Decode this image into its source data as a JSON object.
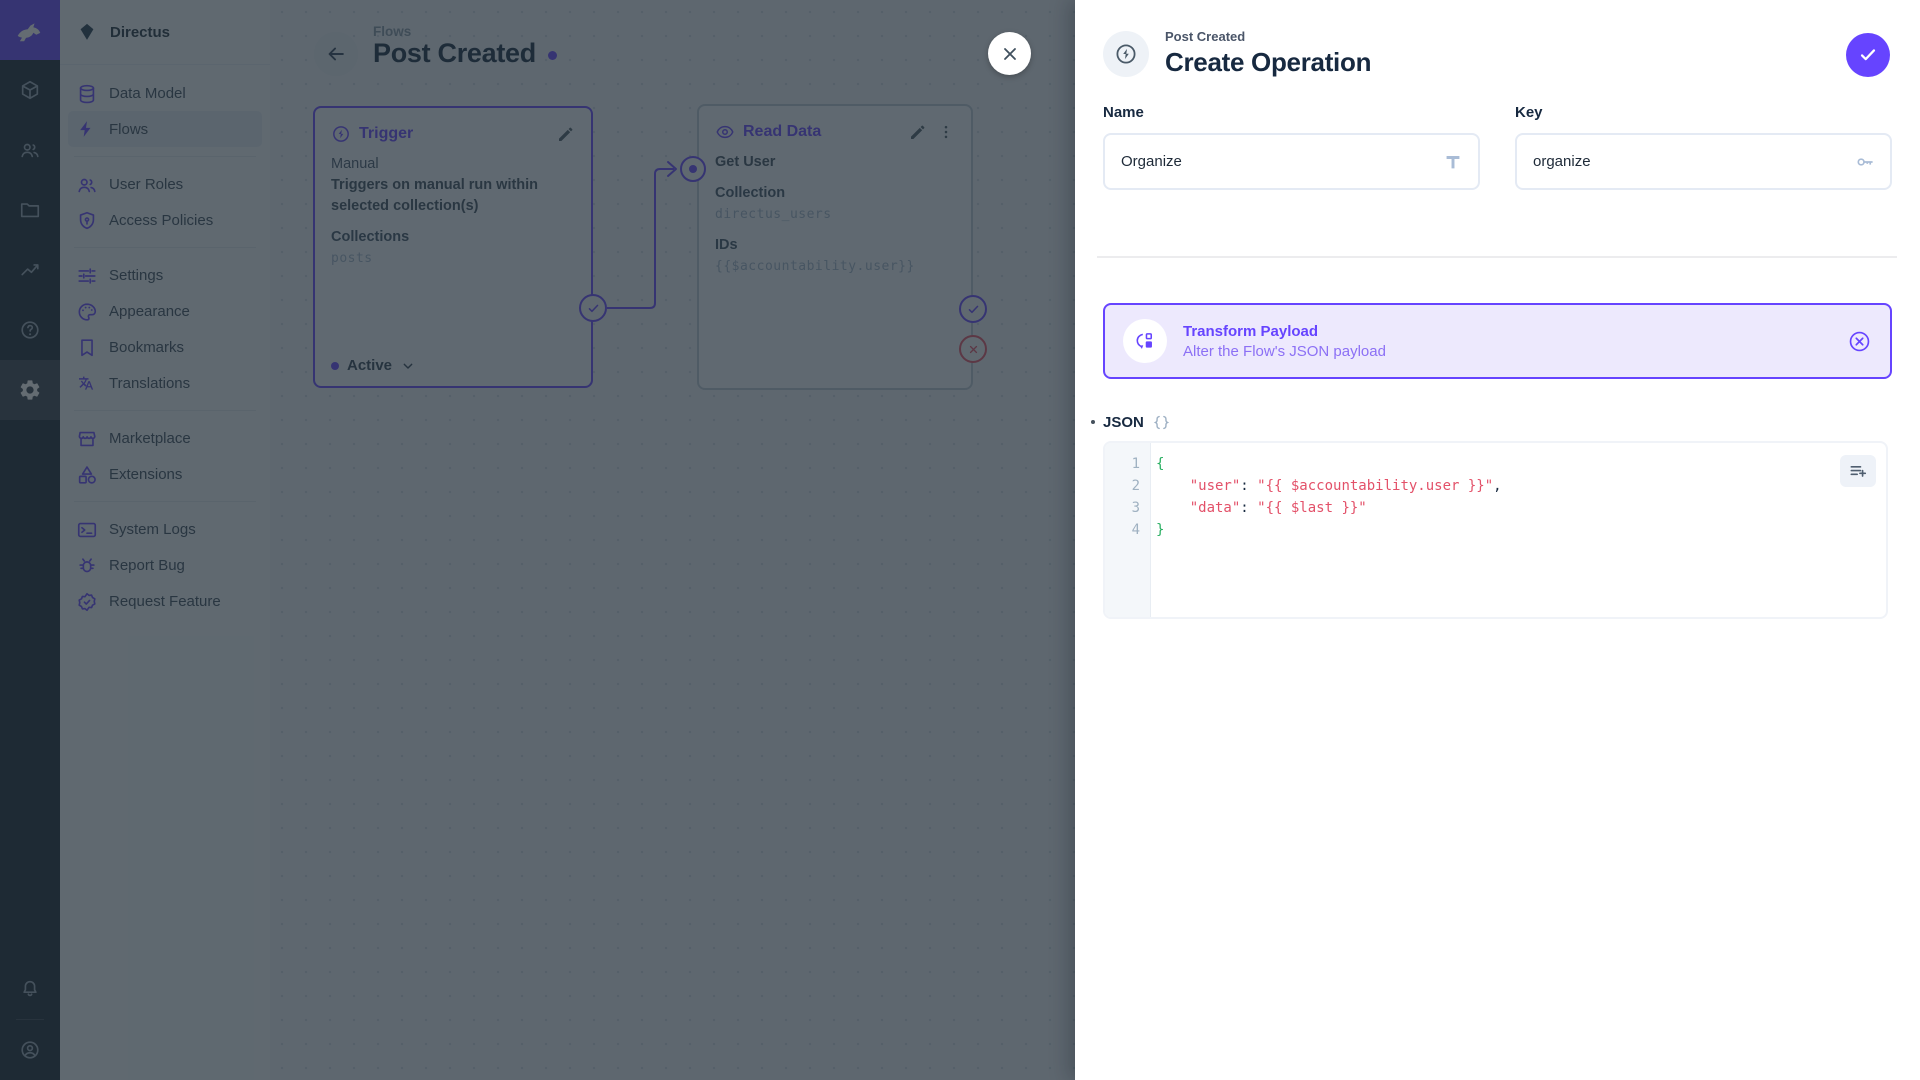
{
  "colors": {
    "accent": "#6644ff",
    "reject": "#e35169",
    "code_string": "#e35169",
    "code_brace": "#27ae60"
  },
  "module_bar": {
    "logo_icon": "directus-rabbit-logo",
    "modules": [
      {
        "icon": "box-icon",
        "active": false
      },
      {
        "icon": "users-icon",
        "active": false
      },
      {
        "icon": "folder-icon",
        "active": false
      },
      {
        "icon": "insights-icon",
        "active": false
      },
      {
        "icon": "help-icon",
        "active": false
      },
      {
        "icon": "gear-icon",
        "active": true
      }
    ],
    "bottom": [
      {
        "icon": "bell-icon"
      },
      {
        "icon": "avatar-icon"
      }
    ]
  },
  "sidebar": {
    "project_name": "Directus",
    "project_icon": "gem-icon",
    "groups": [
      {
        "items": [
          {
            "label": "Data Model",
            "icon": "database-icon",
            "active": false
          },
          {
            "label": "Flows",
            "icon": "bolt-icon",
            "active": true
          }
        ]
      },
      {
        "items": [
          {
            "label": "User Roles",
            "icon": "users-icon",
            "active": false
          },
          {
            "label": "Access Policies",
            "icon": "shield-lock-icon",
            "active": false
          }
        ]
      },
      {
        "items": [
          {
            "label": "Settings",
            "icon": "tune-icon",
            "active": false
          },
          {
            "label": "Appearance",
            "icon": "palette-icon",
            "active": false
          },
          {
            "label": "Bookmarks",
            "icon": "bookmark-icon",
            "active": false
          },
          {
            "label": "Translations",
            "icon": "translate-icon",
            "active": false
          }
        ]
      },
      {
        "items": [
          {
            "label": "Marketplace",
            "icon": "storefront-icon",
            "active": false
          },
          {
            "label": "Extensions",
            "icon": "category-icon",
            "active": false
          }
        ]
      },
      {
        "items": [
          {
            "label": "System Logs",
            "icon": "terminal-icon",
            "active": false
          },
          {
            "label": "Report Bug",
            "icon": "bug-icon",
            "active": false
          },
          {
            "label": "Request Feature",
            "icon": "verified-icon",
            "active": false
          }
        ]
      }
    ]
  },
  "canvas": {
    "breadcrumb": "Flows",
    "title": "Post Created",
    "trigger_card": {
      "title": "Trigger",
      "icon": "bolt-circle-icon",
      "name": "Manual",
      "description": "Triggers on manual run within selected collection(s)",
      "field_label": "Collections",
      "field_value": "posts",
      "status": "Active"
    },
    "operation_card": {
      "title": "Read Data",
      "icon": "eye-icon",
      "name": "Get User",
      "fields": [
        {
          "label": "Collection",
          "value": "directus_users"
        },
        {
          "label": "IDs",
          "value": "{{$accountability.user}}"
        }
      ]
    }
  },
  "drawer": {
    "breadcrumb": "Post Created",
    "title": "Create Operation",
    "header_icon": "bolt-circle-icon",
    "fields": {
      "name_label": "Name",
      "name_value": "Organize",
      "key_label": "Key",
      "key_value": "organize"
    },
    "transform": {
      "title": "Transform Payload",
      "subtitle": "Alter the Flow's JSON payload",
      "icon": "transform-icon"
    },
    "json": {
      "label": "JSON",
      "lines": [
        {
          "segments": [
            {
              "text": "{",
              "style": "brace"
            }
          ]
        },
        {
          "segments": [
            {
              "text": "    ",
              "style": "plain"
            },
            {
              "text": "\"user\"",
              "style": "string"
            },
            {
              "text": ": ",
              "style": "plain"
            },
            {
              "text": "\"{{ $accountability.user }}\"",
              "style": "string"
            },
            {
              "text": ",",
              "style": "plain"
            }
          ]
        },
        {
          "segments": [
            {
              "text": "    ",
              "style": "plain"
            },
            {
              "text": "\"data\"",
              "style": "string"
            },
            {
              "text": ": ",
              "style": "plain"
            },
            {
              "text": "\"{{ $last }}\"",
              "style": "string"
            }
          ]
        },
        {
          "segments": [
            {
              "text": "}",
              "style": "brace"
            }
          ]
        }
      ]
    }
  }
}
